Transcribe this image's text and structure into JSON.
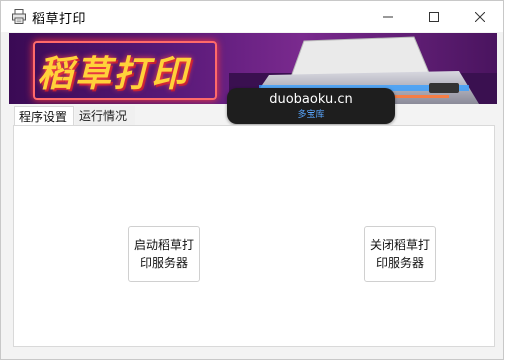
{
  "window": {
    "title": "稻草打印",
    "icons": {
      "app": "printer-icon",
      "minimize": "minimize-icon",
      "maximize": "maximize-icon",
      "close": "close-icon"
    }
  },
  "banner": {
    "title": "稻草打印"
  },
  "watermark": {
    "main": "duobaoku.cn",
    "sub": "多宝库"
  },
  "tabs": [
    {
      "label": "程序设置",
      "active": true
    },
    {
      "label": "运行情况",
      "active": false
    }
  ],
  "buttons": {
    "start_server": "启动稻草打印服务器",
    "stop_server": "关闭稻草打印服务器"
  },
  "colors": {
    "banner_bg": "#5b1a7a",
    "banner_title": "#ffd23a",
    "watermark_sub": "#5aa7ff"
  }
}
